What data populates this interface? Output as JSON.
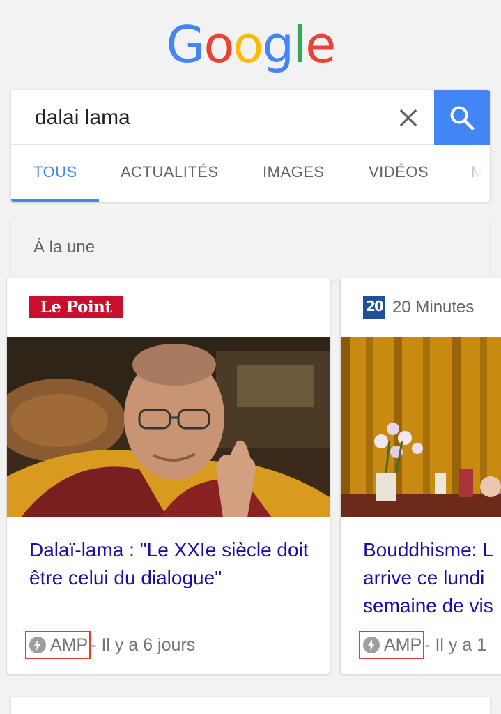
{
  "logo": {
    "letters": [
      "G",
      "o",
      "o",
      "g",
      "l",
      "e"
    ],
    "colors": [
      "#4285f4",
      "#ea4335",
      "#fbbc05",
      "#4285f4",
      "#34a853",
      "#ea4335"
    ]
  },
  "search": {
    "query": "dalai lama",
    "icons": {
      "clear": "close-icon",
      "submit": "search-icon"
    }
  },
  "tabs": [
    {
      "label": "TOUS",
      "active": true
    },
    {
      "label": "ACTUALITÉS",
      "active": false
    },
    {
      "label": "IMAGES",
      "active": false
    },
    {
      "label": "VIDÉOS",
      "active": false
    },
    {
      "label": "MA",
      "active": false
    }
  ],
  "top_stories": {
    "title": "À la une",
    "cards": [
      {
        "source": "Le Point",
        "headline": "Dalaï-lama : \"Le XXIe siècle doit être celui du dialogue\"",
        "amp_label": "AMP",
        "time": " - Il y a 6 jours"
      },
      {
        "source": "20 Minutes",
        "source_logo_text": "20",
        "headline_lines": [
          "Bouddhisme: L",
          "arrive ce lundi",
          "semaine de vis"
        ],
        "amp_label": "AMP",
        "time": " - Il y a 1"
      }
    ]
  },
  "colors": {
    "accent": "#4285f4",
    "headline": "#1a0dab",
    "amp_highlight": "#e53935",
    "le_point_red": "#c8102e",
    "twenty_minutes_blue": "#1f4e9c"
  }
}
